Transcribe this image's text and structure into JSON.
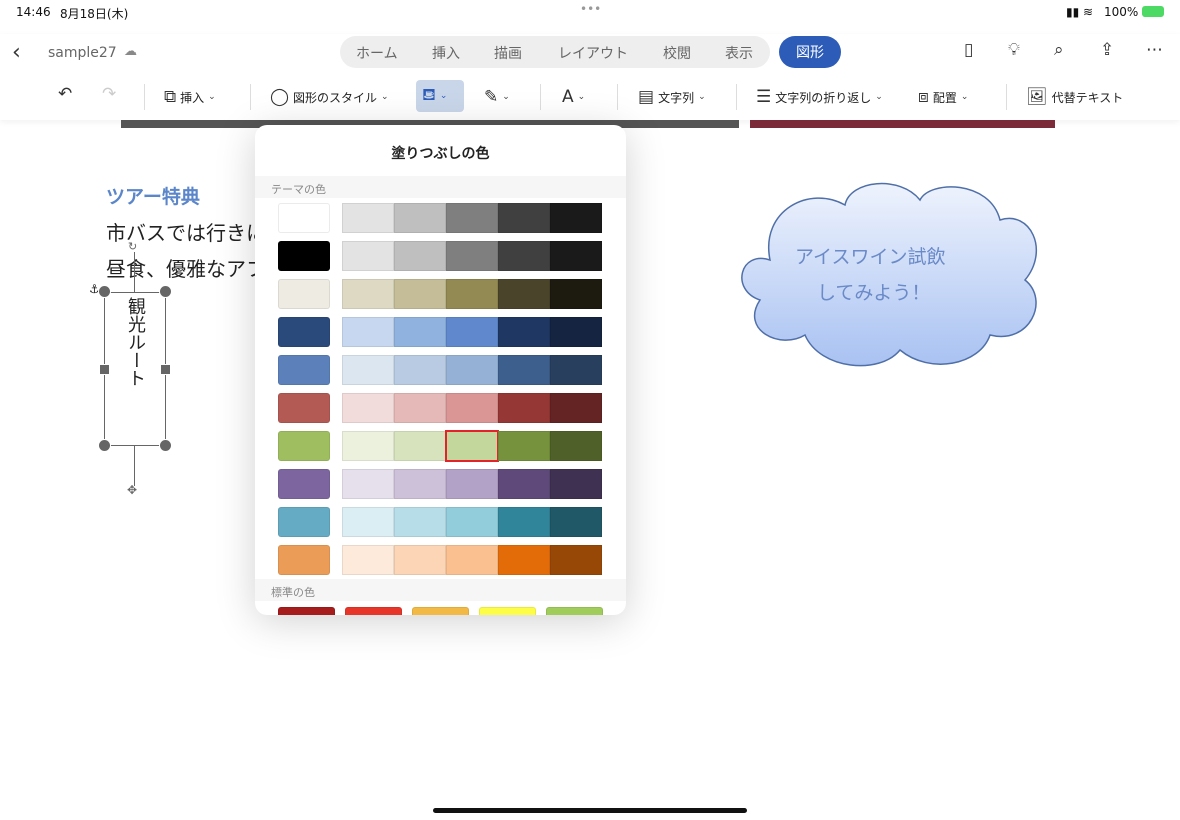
{
  "status": {
    "time": "14:46",
    "date": "8月18日(木)",
    "battery": "100%"
  },
  "header": {
    "doc_name": "sample27",
    "tabs": [
      "ホーム",
      "挿入",
      "描画",
      "レイアウト",
      "校閲",
      "表示"
    ],
    "active_tab": "図形"
  },
  "toolbar": {
    "insert": "挿入",
    "shape_style": "図形のスタイル",
    "text": "文字列",
    "wrap": "文字列の折り返し",
    "arrange": "配置",
    "alt_text": "代替テキスト"
  },
  "document": {
    "heading": "ツアー特典",
    "line1": "市バスでは行きに",
    "line2": "昼食、優雅なアフ",
    "vertical_box": "観光ルート",
    "cloud_text_1": "アイスワイン試飲",
    "cloud_text_2": "してみよう！"
  },
  "fill_popover": {
    "title": "塗りつぶしの色",
    "theme_label": "テーマの色",
    "standard_label": "標準の色",
    "theme_rows": [
      [
        "#ffffff",
        "#e3e3e3",
        "#bfbfbf",
        "#7f7f7f",
        "#404040",
        "#1a1a1a"
      ],
      [
        "#000000",
        "#e3e3e3",
        "#bfbfbf",
        "#7f7f7f",
        "#404040",
        "#1a1a1a"
      ],
      [
        "#eeebe3",
        "#ddd9c3",
        "#c4bd97",
        "#938953",
        "#4a442a",
        "#1d1b10"
      ],
      [
        "#2b4a7c",
        "#c6d7ef",
        "#8fb2de",
        "#5f89cc",
        "#1f3763",
        "#142441"
      ],
      [
        "#5b80ba",
        "#dce6f1",
        "#b8cbe3",
        "#95b2d6",
        "#3c5f8d",
        "#283f5e"
      ],
      [
        "#b45a55",
        "#f2dcdb",
        "#e5b9b7",
        "#d99694",
        "#953734",
        "#632423"
      ],
      [
        "#9fbe60",
        "#ebf1dd",
        "#d7e3bc",
        "#c3d69b",
        "#76923c",
        "#4f6128"
      ],
      [
        "#7d66a0",
        "#e5e0ec",
        "#ccc1d9",
        "#b2a2c7",
        "#5f497a",
        "#3f3151"
      ],
      [
        "#65abc3",
        "#dbeef3",
        "#b7dde8",
        "#92cddc",
        "#31859b",
        "#205867"
      ],
      [
        "#eb9d58",
        "#fdeada",
        "#fbd5b5",
        "#fac08f",
        "#e36c09",
        "#974806"
      ]
    ],
    "selected": {
      "row": 6,
      "col": 3
    },
    "standard": [
      "#a61c1c",
      "#e8352a",
      "#f2b944",
      "#fdfd47",
      "#9fcc5a"
    ]
  },
  "colors": {
    "accent": "#2c5cb8",
    "heading": "#5b86c9",
    "selection": "#e3222a"
  }
}
